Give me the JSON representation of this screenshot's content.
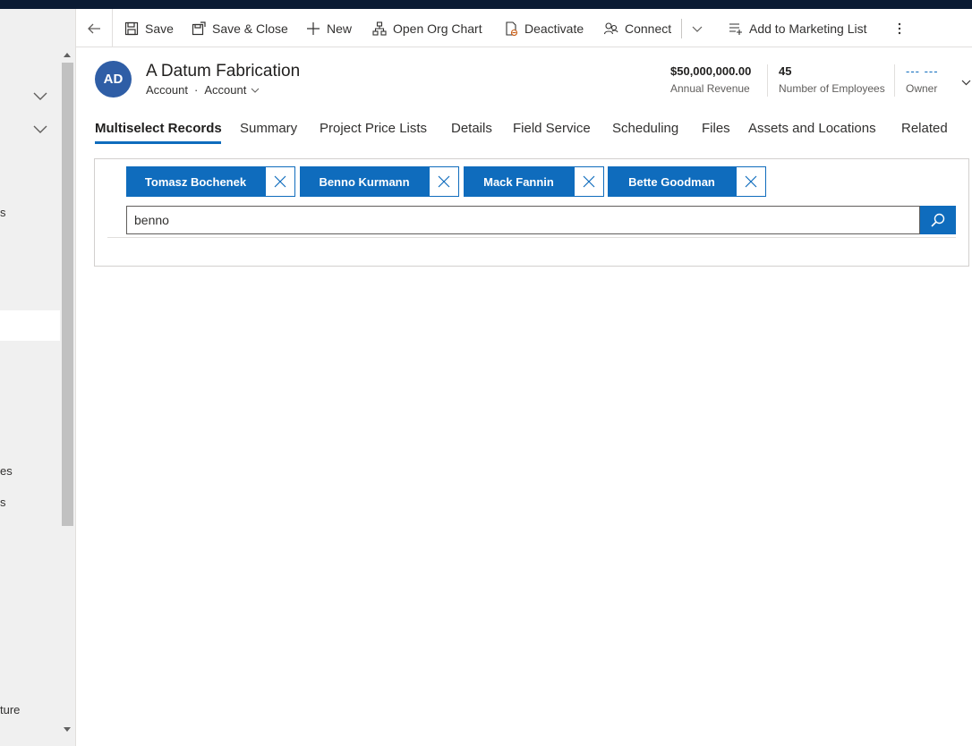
{
  "commandbar": {
    "save": "Save",
    "save_close": "Save & Close",
    "new": "New",
    "open_org_chart": "Open Org Chart",
    "deactivate": "Deactivate",
    "connect": "Connect",
    "add_to_marketing_list": "Add to Marketing List"
  },
  "leftnav": {
    "fragments": [
      "s",
      "es",
      "s",
      "ture"
    ]
  },
  "record": {
    "initials": "AD",
    "title": "A Datum Fabrication",
    "entity": "Account",
    "form": "Account"
  },
  "key_fields": [
    {
      "value": "$50,000,000.00",
      "label": "Annual Revenue"
    },
    {
      "value": "45",
      "label": "Number of Employees"
    },
    {
      "value": "--- ---",
      "label": "Owner"
    }
  ],
  "tabs": [
    "Multiselect Records",
    "Summary",
    "Project Price Lists",
    "Details",
    "Field Service",
    "Scheduling",
    "Files",
    "Assets and Locations",
    "Related"
  ],
  "selected_records": [
    "Tomasz Bochenek",
    "Benno Kurmann",
    "Mack Fannin",
    "Bette Goodman"
  ],
  "search": {
    "value": "benno"
  },
  "colors": {
    "accent": "#0f6cbd",
    "avatar": "#2f5ea6",
    "topbar": "#0b1b33"
  }
}
